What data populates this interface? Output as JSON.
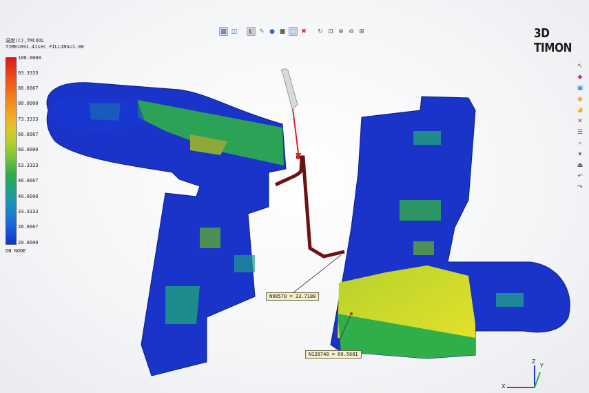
{
  "legend": {
    "quantity": "温度(C),TMCOOL",
    "status": "TIME=691.41sec FILLING=1.00",
    "ticks": [
      "100.0000",
      "93.3333",
      "86.6667",
      "80.0000",
      "73.3333",
      "66.6667",
      "60.0000",
      "53.3333",
      "46.6667",
      "40.0000",
      "33.3333",
      "26.6667",
      "20.0000"
    ],
    "mode": "ON NODE"
  },
  "brand": "3D TIMON",
  "toolbar": {
    "icons": [
      "grid-icon",
      "cube-icon",
      "palette-icon",
      "pencil-icon",
      "sphere-icon",
      "square-icon",
      "select-icon",
      "close-icon",
      "rotate-icon",
      "fit-icon",
      "zoom-in-icon",
      "zoom-out-icon",
      "zoom-window-icon"
    ]
  },
  "side_toolbar": {
    "icons": [
      "pointer-icon",
      "pick-icon",
      "box-icon",
      "cylinder-icon",
      "color-icon",
      "close-icon",
      "list-icon",
      "search-icon",
      "marker-icon",
      "lock-icon",
      "undo-icon",
      "redo-icon"
    ]
  },
  "callouts": {
    "node1": "N90570 = 33.7188",
    "node2": "N128748 = 69.5681"
  },
  "axes": {
    "x": "X",
    "y": "Y",
    "z": "Z"
  },
  "colors": {
    "hot": "#d81b1b",
    "cold": "#1133c8",
    "callout_bg": "#f3f0c8"
  }
}
